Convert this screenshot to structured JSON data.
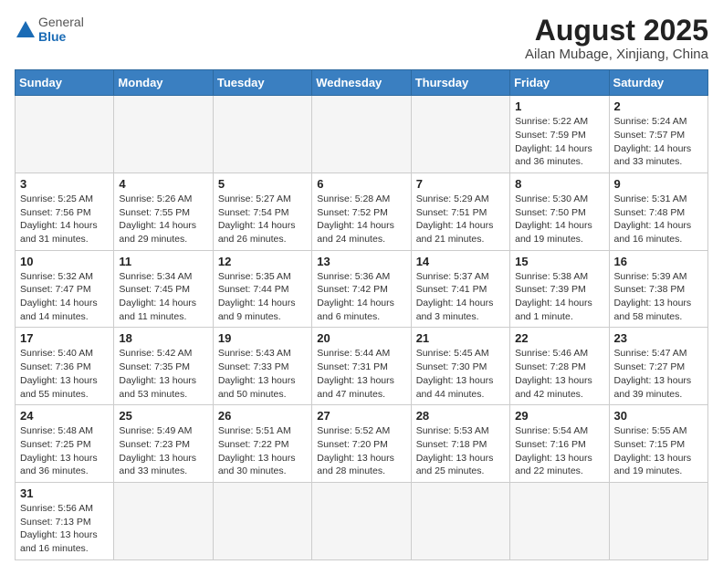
{
  "header": {
    "logo_text_general": "General",
    "logo_text_blue": "Blue",
    "month_year": "August 2025",
    "location": "Ailan Mubage, Xinjiang, China"
  },
  "days_of_week": [
    "Sunday",
    "Monday",
    "Tuesday",
    "Wednesday",
    "Thursday",
    "Friday",
    "Saturday"
  ],
  "weeks": [
    [
      {
        "day": "",
        "info": ""
      },
      {
        "day": "",
        "info": ""
      },
      {
        "day": "",
        "info": ""
      },
      {
        "day": "",
        "info": ""
      },
      {
        "day": "",
        "info": ""
      },
      {
        "day": "1",
        "info": "Sunrise: 5:22 AM\nSunset: 7:59 PM\nDaylight: 14 hours and 36 minutes."
      },
      {
        "day": "2",
        "info": "Sunrise: 5:24 AM\nSunset: 7:57 PM\nDaylight: 14 hours and 33 minutes."
      }
    ],
    [
      {
        "day": "3",
        "info": "Sunrise: 5:25 AM\nSunset: 7:56 PM\nDaylight: 14 hours and 31 minutes."
      },
      {
        "day": "4",
        "info": "Sunrise: 5:26 AM\nSunset: 7:55 PM\nDaylight: 14 hours and 29 minutes."
      },
      {
        "day": "5",
        "info": "Sunrise: 5:27 AM\nSunset: 7:54 PM\nDaylight: 14 hours and 26 minutes."
      },
      {
        "day": "6",
        "info": "Sunrise: 5:28 AM\nSunset: 7:52 PM\nDaylight: 14 hours and 24 minutes."
      },
      {
        "day": "7",
        "info": "Sunrise: 5:29 AM\nSunset: 7:51 PM\nDaylight: 14 hours and 21 minutes."
      },
      {
        "day": "8",
        "info": "Sunrise: 5:30 AM\nSunset: 7:50 PM\nDaylight: 14 hours and 19 minutes."
      },
      {
        "day": "9",
        "info": "Sunrise: 5:31 AM\nSunset: 7:48 PM\nDaylight: 14 hours and 16 minutes."
      }
    ],
    [
      {
        "day": "10",
        "info": "Sunrise: 5:32 AM\nSunset: 7:47 PM\nDaylight: 14 hours and 14 minutes."
      },
      {
        "day": "11",
        "info": "Sunrise: 5:34 AM\nSunset: 7:45 PM\nDaylight: 14 hours and 11 minutes."
      },
      {
        "day": "12",
        "info": "Sunrise: 5:35 AM\nSunset: 7:44 PM\nDaylight: 14 hours and 9 minutes."
      },
      {
        "day": "13",
        "info": "Sunrise: 5:36 AM\nSunset: 7:42 PM\nDaylight: 14 hours and 6 minutes."
      },
      {
        "day": "14",
        "info": "Sunrise: 5:37 AM\nSunset: 7:41 PM\nDaylight: 14 hours and 3 minutes."
      },
      {
        "day": "15",
        "info": "Sunrise: 5:38 AM\nSunset: 7:39 PM\nDaylight: 14 hours and 1 minute."
      },
      {
        "day": "16",
        "info": "Sunrise: 5:39 AM\nSunset: 7:38 PM\nDaylight: 13 hours and 58 minutes."
      }
    ],
    [
      {
        "day": "17",
        "info": "Sunrise: 5:40 AM\nSunset: 7:36 PM\nDaylight: 13 hours and 55 minutes."
      },
      {
        "day": "18",
        "info": "Sunrise: 5:42 AM\nSunset: 7:35 PM\nDaylight: 13 hours and 53 minutes."
      },
      {
        "day": "19",
        "info": "Sunrise: 5:43 AM\nSunset: 7:33 PM\nDaylight: 13 hours and 50 minutes."
      },
      {
        "day": "20",
        "info": "Sunrise: 5:44 AM\nSunset: 7:31 PM\nDaylight: 13 hours and 47 minutes."
      },
      {
        "day": "21",
        "info": "Sunrise: 5:45 AM\nSunset: 7:30 PM\nDaylight: 13 hours and 44 minutes."
      },
      {
        "day": "22",
        "info": "Sunrise: 5:46 AM\nSunset: 7:28 PM\nDaylight: 13 hours and 42 minutes."
      },
      {
        "day": "23",
        "info": "Sunrise: 5:47 AM\nSunset: 7:27 PM\nDaylight: 13 hours and 39 minutes."
      }
    ],
    [
      {
        "day": "24",
        "info": "Sunrise: 5:48 AM\nSunset: 7:25 PM\nDaylight: 13 hours and 36 minutes."
      },
      {
        "day": "25",
        "info": "Sunrise: 5:49 AM\nSunset: 7:23 PM\nDaylight: 13 hours and 33 minutes."
      },
      {
        "day": "26",
        "info": "Sunrise: 5:51 AM\nSunset: 7:22 PM\nDaylight: 13 hours and 30 minutes."
      },
      {
        "day": "27",
        "info": "Sunrise: 5:52 AM\nSunset: 7:20 PM\nDaylight: 13 hours and 28 minutes."
      },
      {
        "day": "28",
        "info": "Sunrise: 5:53 AM\nSunset: 7:18 PM\nDaylight: 13 hours and 25 minutes."
      },
      {
        "day": "29",
        "info": "Sunrise: 5:54 AM\nSunset: 7:16 PM\nDaylight: 13 hours and 22 minutes."
      },
      {
        "day": "30",
        "info": "Sunrise: 5:55 AM\nSunset: 7:15 PM\nDaylight: 13 hours and 19 minutes."
      }
    ],
    [
      {
        "day": "31",
        "info": "Sunrise: 5:56 AM\nSunset: 7:13 PM\nDaylight: 13 hours and 16 minutes."
      },
      {
        "day": "",
        "info": ""
      },
      {
        "day": "",
        "info": ""
      },
      {
        "day": "",
        "info": ""
      },
      {
        "day": "",
        "info": ""
      },
      {
        "day": "",
        "info": ""
      },
      {
        "day": "",
        "info": ""
      }
    ]
  ]
}
